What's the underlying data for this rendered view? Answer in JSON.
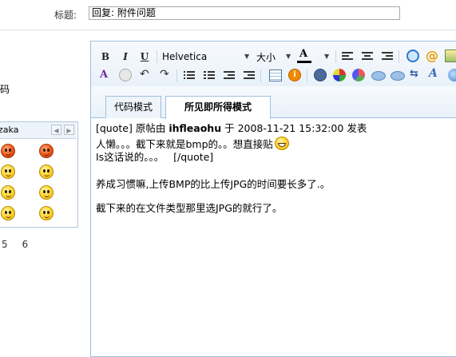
{
  "title_row": {
    "label": "标题:",
    "value": "回复: 附件问题"
  },
  "left_panel": {
    "char": "码",
    "smiley_header_label": "zaka",
    "page_numbers": "5 6"
  },
  "toolbar": {
    "bold": "B",
    "italic": "I",
    "underline": "U",
    "font_name": "Helvetica",
    "font_size": "大小",
    "font_color": "A"
  },
  "tabs": [
    {
      "label": "代码模式",
      "active": false
    },
    {
      "label": "所见即所得模式",
      "active": true
    }
  ],
  "content": {
    "quote_open": "[quote]",
    "quote_by": "原帖由",
    "quote_author": "ihfleaohu",
    "quote_at": "于",
    "quote_date": "2008-11-21 15:32:00",
    "quote_posted": "发表",
    "line2": "人懒。。。截下来就是bmp的。。想直接贴",
    "line3": "Is这话说的。。。",
    "quote_close": "[/quote]",
    "para1": "养成习惯嘛,上传BMP的比上传JPG的时间要长多了.。",
    "para2": "截下来的在文件类型那里选JPG的就行了。"
  },
  "colors": {
    "editor_border": "#9ebfe0",
    "toolbar_bg": "#e9f1f9",
    "font_color_bar": "#000000",
    "text": "#000000"
  }
}
